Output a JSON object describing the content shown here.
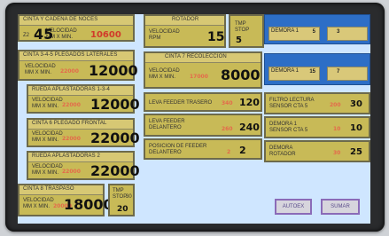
{
  "panels": {
    "cinta_cadena": {
      "title": "CINTA Y CADENA DE NOCES",
      "speed_label": "VELOCIDAD",
      "unit": "mm x Min.",
      "value": "45",
      "setpoint": "10600",
      "small": "Z2"
    },
    "rotador": {
      "title": "ROTADOR",
      "speed_label": "VELOCIDAD",
      "unit": "RPM",
      "value": "15"
    },
    "tmp_stop_1": {
      "label": "TMP",
      "label2": "STOP",
      "value": "5"
    },
    "cinta_plegados": {
      "title": "CINTA 3-4-5 PLEGADOS LATERALES",
      "speed_label": "VELOCIDAD",
      "unit": "mm x Min.",
      "setpoint": "22000",
      "value": "12000"
    },
    "cinta_recoleccion": {
      "title": "CINTA 7 RECOLECCION",
      "speed_label": "VELOCIDAD",
      "unit": "mm x Min.",
      "setpoint": "17000",
      "value": "8000"
    },
    "rueda_aplastadoras_1": {
      "title": "RUEDA APLASTADORAS 1-3-4",
      "speed_label": "VELOCIDAD",
      "unit": "mm x Min.",
      "setpoint": "22000",
      "value": "12000"
    },
    "leva_trasero": {
      "title": "LEVA FEEDER TRASERO",
      "setpoint": "340",
      "value": "120"
    },
    "cinta_plegado_frontal": {
      "title": "CINTA 6 PLEGADO FRONTAL",
      "speed_label": "VELOCIDAD",
      "unit": "mm x Min.",
      "setpoint": "22000",
      "value": "22000"
    },
    "leva_delantero": {
      "title": "LEVA FEEDER",
      "title2": "DELANTERO",
      "setpoint": "260",
      "value": "240"
    },
    "rueda_aplastadoras_2": {
      "title": "RUEDA APLASTADORAS 2",
      "speed_label": "VELOCIDAD",
      "unit": "mm x Min.",
      "setpoint": "22000",
      "value": "22000"
    },
    "posicion_feeder": {
      "title": "POSICION DE FEEDER",
      "title2": "DELANTERO",
      "setpoint": "2",
      "value": "2"
    },
    "cinta_transfer": {
      "title": "CINTA 8 TRASPASO",
      "speed_label": "VELOCIDAD",
      "unit": "mm x Min.",
      "setpoint": "20000",
      "value": "18000"
    },
    "tmp_stop_2": {
      "label": "TMP",
      "label2": "STOP",
      "value": "20",
      "small": "30"
    }
  },
  "right_column": {
    "demora_1": "DEMORA 1",
    "demora_2": "DEMORA 1",
    "demora_1_value": "5",
    "demora_2_value": "15",
    "demora_2_small": "7",
    "demora_1_small": "3",
    "filtro": {
      "title1": "FILTRO LECTURA",
      "title2": "SENSOR CTA 5",
      "setpoint": "200",
      "value": "30"
    },
    "demora_sensor": {
      "title1": "DEMORA 1",
      "title2": "SENSOR CTA 5",
      "setpoint": "10",
      "value": "10"
    },
    "demora_rotador": {
      "title1": "DEMORA",
      "title2": "ROTADOR",
      "setpoint": "30",
      "value": "25"
    }
  },
  "buttons": {
    "auto": "AUTOEX",
    "manual": "SUMAR"
  }
}
